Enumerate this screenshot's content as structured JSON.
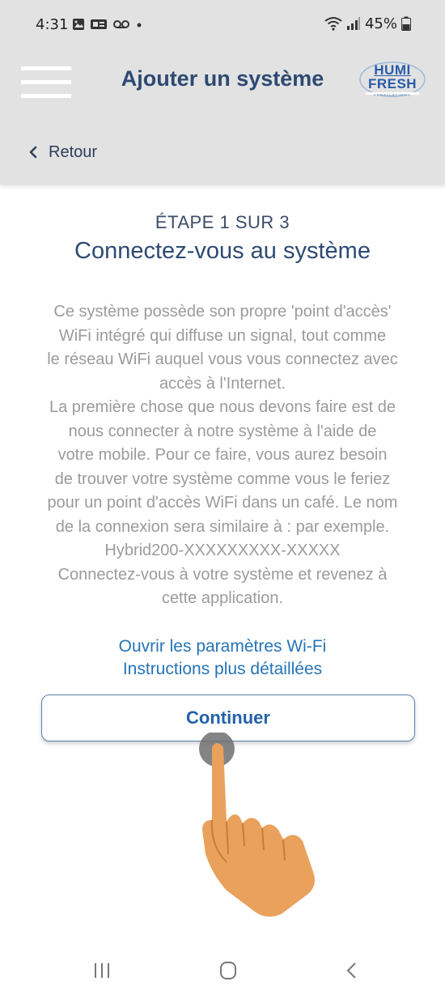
{
  "status_bar": {
    "time": "4:31",
    "battery": "45%"
  },
  "header": {
    "title": "Ajouter un système",
    "logo_text_line1": "HUMI",
    "logo_text_line2": "FRESH",
    "menu_icon": "hamburger-menu-icon"
  },
  "nav": {
    "back_label": "Retour"
  },
  "content": {
    "step": "ÉTAPE 1 SUR 3",
    "title": "Connectez-vous au système",
    "description_lines": [
      "Ce système possède son propre 'point d'accès'",
      "WiFi intégré qui diffuse un signal, tout comme",
      "le réseau WiFi auquel vous vous connectez avec",
      "accès à l'Internet.",
      "La première chose que nous devons faire est de",
      "nous connecter à notre système à l'aide de",
      "votre mobile. Pour ce faire, vous aurez besoin",
      "de trouver votre système comme vous le feriez",
      "pour un point d'accès WiFi dans un café. Le nom",
      "de la connexion sera similaire à : par exemple.",
      "Hybrid200-XXXXXXXXX-XXXXX",
      "Connectez-vous à votre système et revenez à",
      "cette application."
    ],
    "link_wifi_settings": "Ouvrir les paramètres Wi-Fi",
    "link_detailed_instructions": "Instructions plus détaillées",
    "continue_label": "Continuer"
  },
  "colors": {
    "header_bg": "#e2e2e3",
    "title_blue": "#2e4a72",
    "link_blue": "#2574b8",
    "hand_skin": "#e9a15c"
  }
}
